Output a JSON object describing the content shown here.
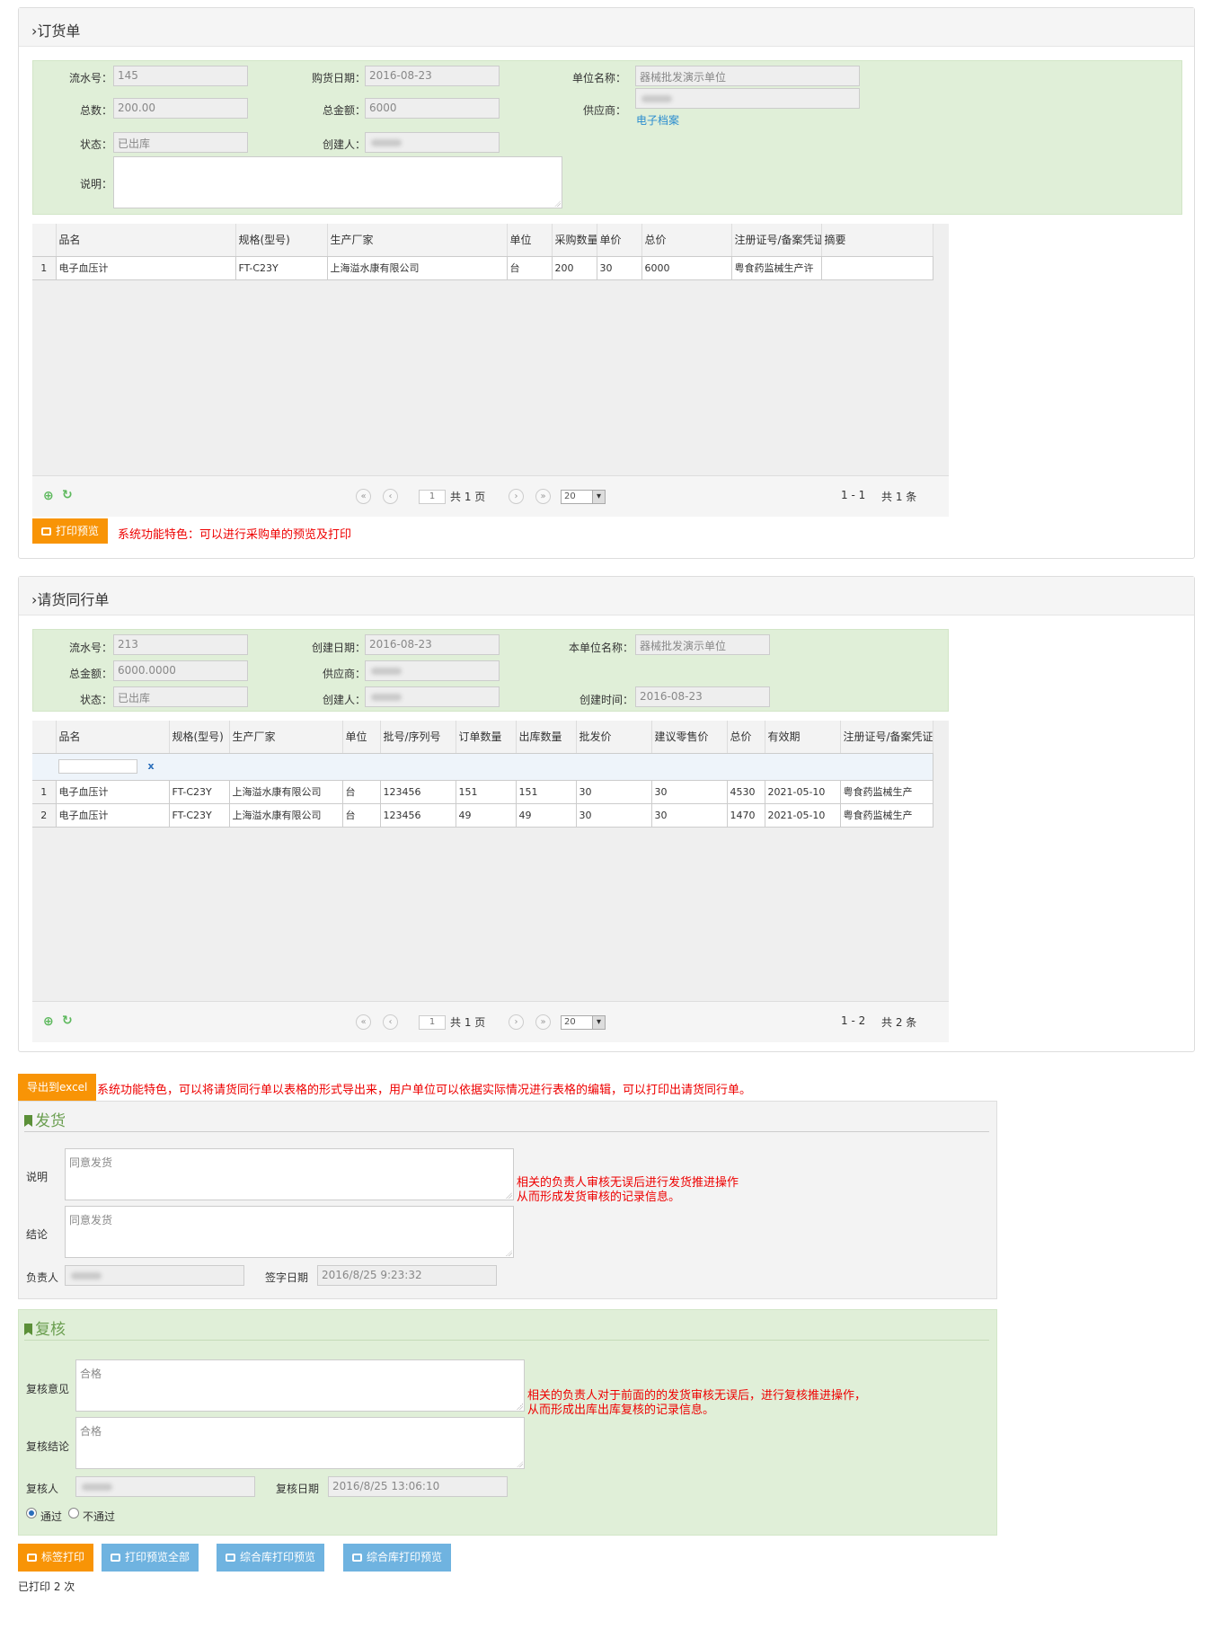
{
  "order": {
    "title": "订货单",
    "fields": {
      "serial_label": "流水号：",
      "serial": "145",
      "purchase_date_label": "购货日期：",
      "purchase_date": "2016-08-23",
      "unit_label": "单位名称：",
      "unit": "器械批发演示单位",
      "count_label": "总数：",
      "count": "200.00",
      "total_label": "总金额：",
      "total": "6000",
      "supplier_label": "供应商：",
      "supplier_link": "电子档案",
      "status_label": "状态：",
      "status": "已出库",
      "creator_label": "创建人：",
      "note_label": "说明："
    },
    "grid": {
      "headers": [
        "",
        "品名",
        "规格(型号)",
        "生产厂家",
        "单位",
        "采购数量",
        "单价",
        "总价",
        "注册证号/备案凭证号",
        "摘要"
      ],
      "rows": [
        [
          "1",
          "电子血压计",
          "FT-C23Y",
          "上海溢水康有限公司",
          "台",
          "200",
          "30",
          "6000",
          "粤食药监械生产许",
          ""
        ]
      ]
    },
    "pager": {
      "page": "1",
      "pages": "共 1 页",
      "size": "20",
      "range": "1 - 1",
      "count": "共 1 条"
    },
    "print_button": "打印预览",
    "note": "系统功能特色：可以进行采购单的预览及打印"
  },
  "request": {
    "title": "请货同行单",
    "fields": {
      "serial_label": "流水号：",
      "serial": "213",
      "created_date_label": "创建日期：",
      "created_date": "2016-08-23",
      "unit_label": "本单位名称：",
      "unit": "器械批发演示单位",
      "total_label": "总金额：",
      "total": "6000.0000",
      "supplier_label": "供应商：",
      "status_label": "状态：",
      "status": "已出库",
      "creator_label": "创建人：",
      "created_time_label": "创建时间：",
      "created_time": "2016-08-23"
    },
    "grid": {
      "headers": [
        "",
        "品名",
        "规格(型号)",
        "生产厂家",
        "单位",
        "批号/序列号",
        "订单数量",
        "出库数量",
        "批发价",
        "建议零售价",
        "总价",
        "有效期",
        "注册证号/备案凭证号"
      ],
      "filter_clear": "x",
      "rows": [
        [
          "1",
          "电子血压计",
          "FT-C23Y",
          "上海溢水康有限公司",
          "台",
          "123456",
          "151",
          "151",
          "30",
          "30",
          "4530",
          "2021-05-10",
          "粤食药监械生产"
        ],
        [
          "2",
          "电子血压计",
          "FT-C23Y",
          "上海溢水康有限公司",
          "台",
          "123456",
          "49",
          "49",
          "30",
          "30",
          "1470",
          "2021-05-10",
          "粤食药监械生产"
        ]
      ]
    },
    "pager": {
      "page": "1",
      "pages": "共 1 页",
      "size": "20",
      "range": "1 - 2",
      "count": "共 2 条"
    }
  },
  "export": {
    "button": "导出到excel",
    "note": "系统功能特色，可以将请货同行单以表格的形式导出来，用户单位可以依据实际情况进行表格的编辑，可以打印出请货同行单。"
  },
  "ship": {
    "title": "发货",
    "desc_label": "说明",
    "desc": "同意发货",
    "conclusion_label": "结论",
    "conclusion": "同意发货",
    "owner_label": "负责人",
    "sign_date_label": "签字日期",
    "sign_date": "2016/8/25 9:23:32",
    "note_line1": "相关的负责人审核无误后进行发货推进操作",
    "note_line2": "从而形成发货审核的记录信息。"
  },
  "review": {
    "title": "复核",
    "opinion_label": "复核意见",
    "opinion": "合格",
    "conclusion_label": "复核结论",
    "conclusion": "合格",
    "reviewer_label": "复核人",
    "date_label": "复核日期",
    "date": "2016/8/25 13:06:10",
    "pass_label": "通过",
    "fail_label": "不通过",
    "note_line1": "相关的负责人对于前面的的发货审核无误后，进行复核推进操作，",
    "note_line2": "从而形成出库出库复核的记录信息。"
  },
  "actions": {
    "label_print": "标签打印",
    "print_all": "打印预览全部",
    "warehouse_print1": "综合库打印预览",
    "warehouse_print2": "综合库打印预览",
    "print_count": "已打印 2 次"
  }
}
